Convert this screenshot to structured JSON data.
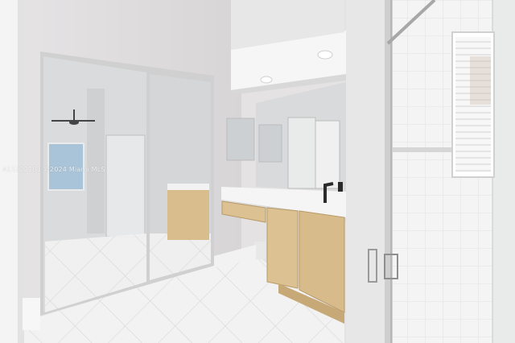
{
  "scene": {
    "description_name": "bathroom-photo",
    "watermark": "A11222181 ©2024 Miami MLS",
    "colors": {
      "wall": "#dcdadb",
      "ceiling": "#efeeee",
      "floor_tile": "#f3f3f3",
      "cabinet_wood": "#dcc193",
      "cabinet_shadow": "#c7a877",
      "counter": "#f2f2f2",
      "mirror": "#cfd2d4",
      "glass": "#e4e7e8",
      "frame": "#c9c9c9"
    }
  }
}
